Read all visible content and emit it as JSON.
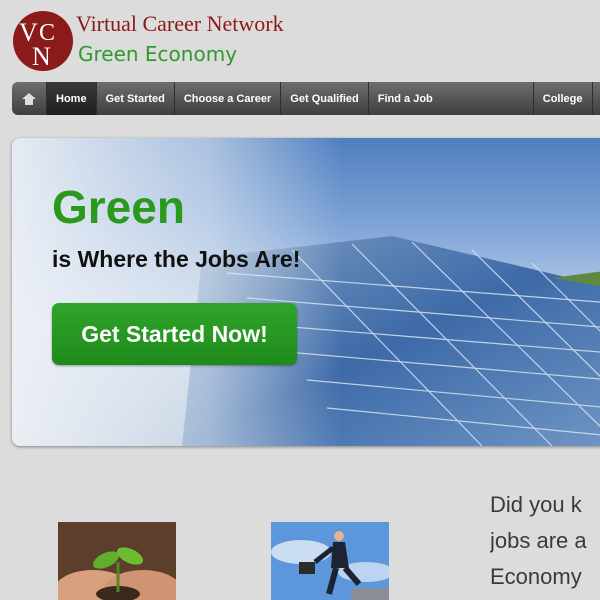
{
  "brand": {
    "logo_letters": "VCN",
    "title": "Virtual Career Network",
    "subtitle": "Green Economy",
    "colors": {
      "logo": "#8b1a1a",
      "subtitle": "#2e9a2e"
    }
  },
  "nav": {
    "home_icon": "home-icon",
    "items": [
      {
        "label": "Home",
        "active": true
      },
      {
        "label": "Get Started",
        "active": false
      },
      {
        "label": "Choose a Career",
        "active": false
      },
      {
        "label": "Get Qualified",
        "active": false
      },
      {
        "label": "Find a Job",
        "active": false
      },
      {
        "label": "College",
        "active": false
      }
    ]
  },
  "hero": {
    "headline": "Green",
    "subline": "is Where the Jobs Are!",
    "cta_label": "Get Started Now!",
    "colors": {
      "headline": "#2a9a1e",
      "cta": "#2fa52a"
    }
  },
  "content": {
    "intro_lines": [
      "Did you k",
      "jobs are a",
      "Economy"
    ],
    "thumbnails": [
      "plant-in-hands-image",
      "businessman-running-image"
    ]
  }
}
